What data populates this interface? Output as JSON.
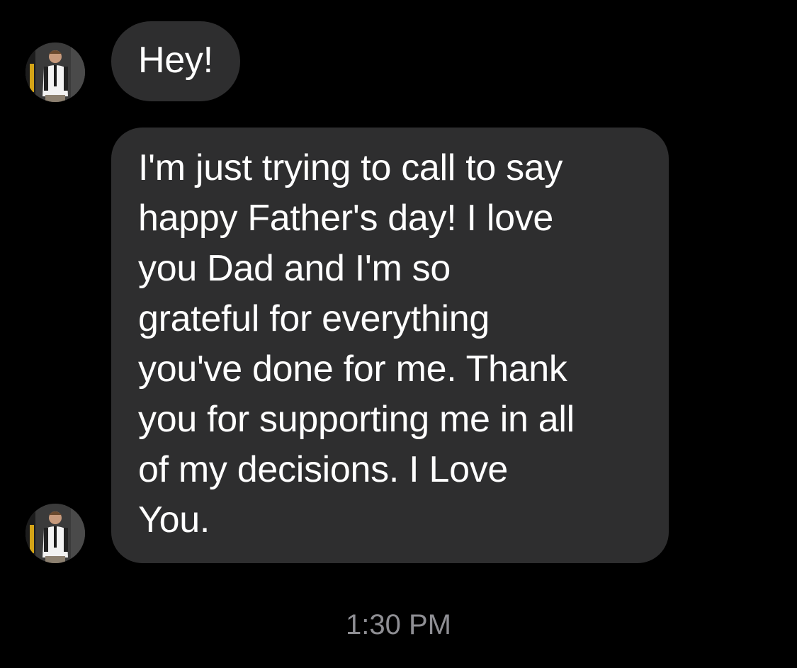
{
  "messages": [
    {
      "text": "Hey!"
    },
    {
      "text": "I'm just trying to call to say\nhappy Father's day! I love\nyou Dad and I'm so\ngrateful for everything\nyou've done for me. Thank\nyou for supporting me in all\nof my decisions. I Love\nYou."
    }
  ],
  "timestamp": "1:30 PM",
  "colors": {
    "background": "#000000",
    "bubble": "#2e2e2f",
    "text": "#ffffff",
    "timestamp": "#8e8e93"
  }
}
